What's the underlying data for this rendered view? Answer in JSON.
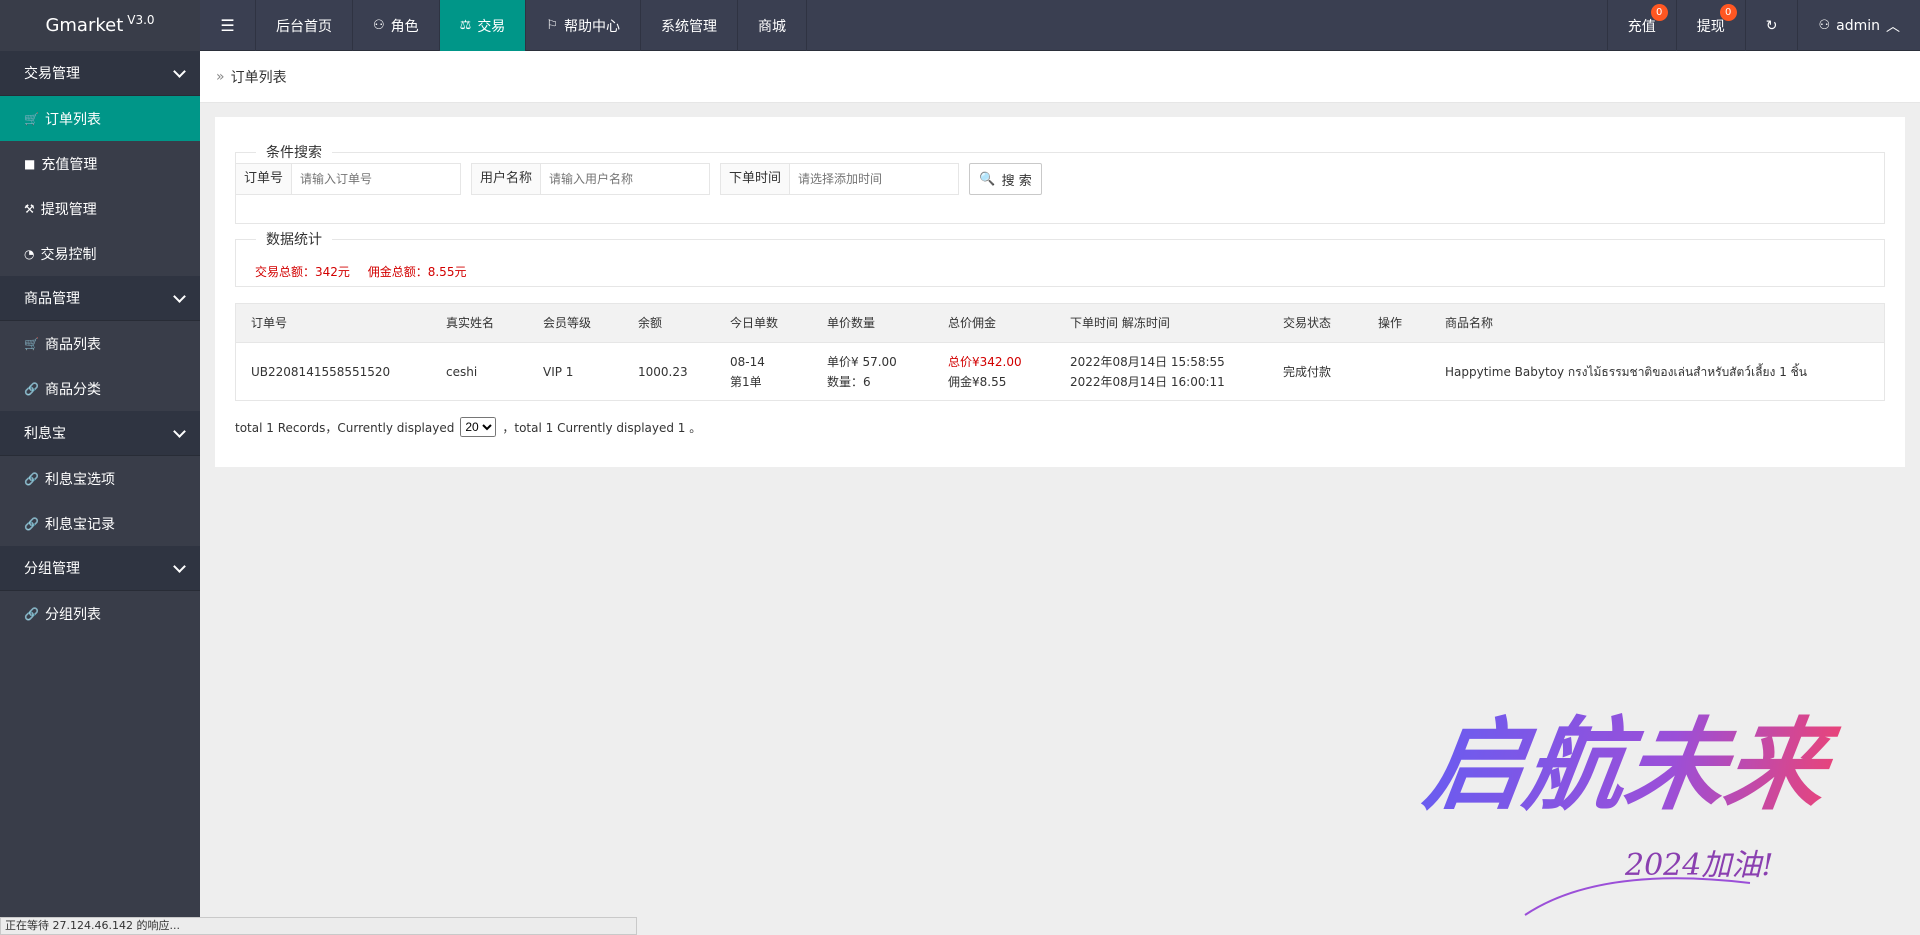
{
  "app": {
    "name": "Gmarket",
    "version": "V3.0"
  },
  "nav": {
    "menu_icon": "menu-icon",
    "items": [
      {
        "label": "后台首页"
      },
      {
        "label": "角色",
        "icon": "user-icon"
      },
      {
        "label": "交易",
        "icon": "balance-icon"
      },
      {
        "label": "帮助中心",
        "icon": "flag-icon"
      },
      {
        "label": "系统管理"
      },
      {
        "label": "商城"
      }
    ]
  },
  "right_nav": {
    "recharge": {
      "label": "充值",
      "badge": "0"
    },
    "withdraw": {
      "label": "提现",
      "badge": "0"
    },
    "refresh_icon": "refresh-icon",
    "user": {
      "label": "admin"
    }
  },
  "sidebar": {
    "groups": [
      {
        "label": "交易管理",
        "items": [
          "订单列表",
          "充值管理",
          "提现管理",
          "交易控制"
        ]
      },
      {
        "label": "商品管理",
        "items": [
          "商品列表",
          "商品分类"
        ]
      },
      {
        "label": "利息宝",
        "items": [
          "利息宝选项",
          "利息宝记录"
        ]
      },
      {
        "label": "分组管理",
        "items": [
          "分组列表"
        ]
      }
    ]
  },
  "breadcrumb": {
    "label": "订单列表"
  },
  "search": {
    "legend": "条件搜索",
    "order_no": {
      "label": "订单号",
      "placeholder": "请输入订单号"
    },
    "username": {
      "label": "用户名称",
      "placeholder": "请输入用户名称"
    },
    "order_time": {
      "label": "下单时间",
      "placeholder": "请选择添加时间"
    },
    "button": "搜 索"
  },
  "stats": {
    "legend": "数据统计",
    "total_trade": "交易总额：342元",
    "total_commission": "佣金总额：8.55元"
  },
  "table": {
    "headers": [
      "订单号",
      "真实姓名",
      "会员等级",
      "余额",
      "今日单数",
      "单价数量",
      "总价佣金",
      "下单时间 解冻时间",
      "交易状态",
      "操作",
      "商品名称"
    ],
    "rows": [
      {
        "order_no": "UB2208141558551520",
        "real_name": "ceshi",
        "level": "VIP 1",
        "balance": "1000.23",
        "today_date": "08-14",
        "today_count": "第1单",
        "unit_price": "单价¥  57.00",
        "quantity": "数量：6",
        "total_price": "总价¥342.00",
        "commission": "佣金¥8.55",
        "order_time": "2022年08月14日 15:58:55",
        "unfreeze_time": "2022年08月14日 16:00:11",
        "status": "完成付款",
        "product": "Happytime Babytoy กรงไม้ธรรมชาติของเล่นสำหรับสัตว์เลี้ยง 1 ชิ้น"
      }
    ]
  },
  "pager": {
    "prefix": "total 1 Records，Currently displayed",
    "page_size": "20",
    "suffix": "，total 1 Currently displayed 1 。"
  },
  "statusbar": {
    "text": "正在等待 27.124.46.142 的响应..."
  },
  "watermark": {
    "main": "启航未来",
    "sub": "2024加油!"
  },
  "colors": {
    "accent": "#009688",
    "header": "#3a3f51",
    "sidebar": "#393d49",
    "badge": "#ff5722",
    "stat_red": "#d20000"
  }
}
